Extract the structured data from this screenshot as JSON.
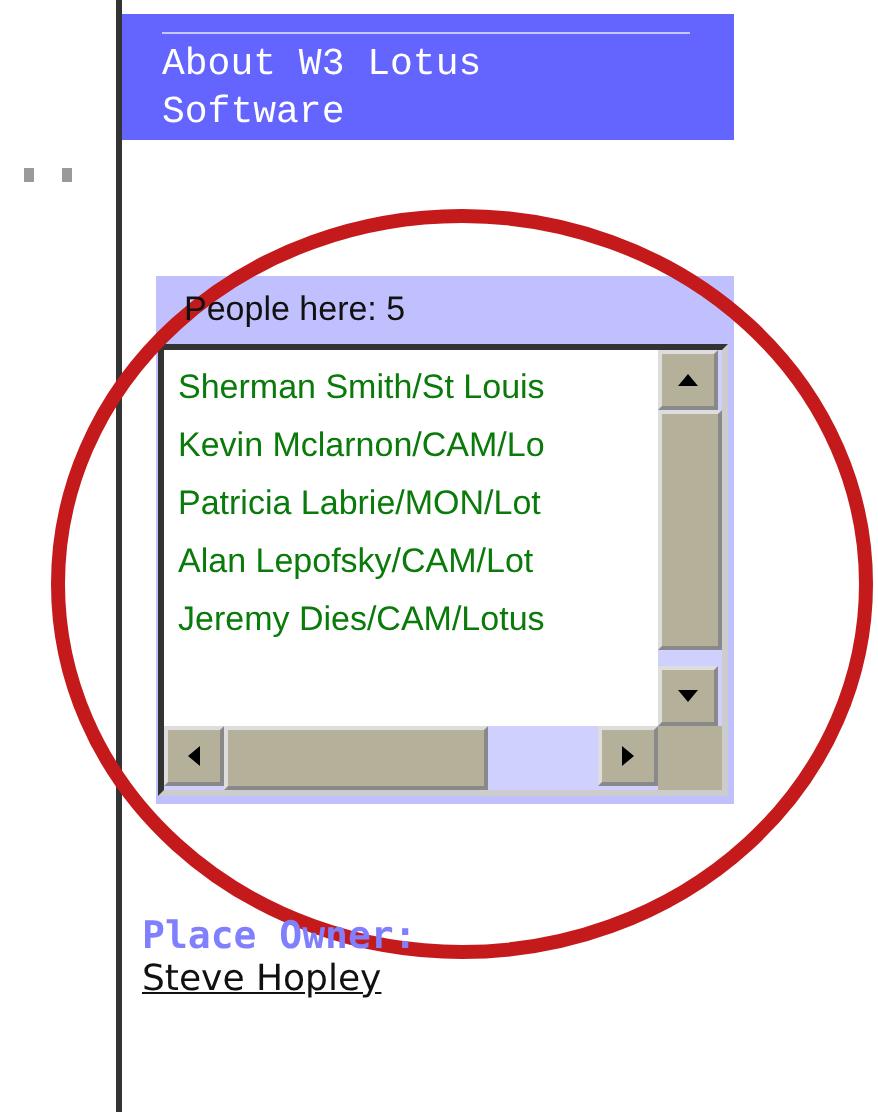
{
  "nav_link": {
    "label": "About W3 Lotus Software"
  },
  "people_panel": {
    "title": "People here: 5",
    "people": [
      {
        "name": "Sherman Smith/St Louis"
      },
      {
        "name": "Kevin Mclarnon/CAM/Lo"
      },
      {
        "name": "Patricia Labrie/MON/Lot"
      },
      {
        "name": "Alan Lepofsky/CAM/Lot"
      },
      {
        "name": "Jeremy Dies/CAM/Lotus"
      }
    ]
  },
  "place_owner": {
    "label": "Place Owner:",
    "name": "Steve Hopley"
  },
  "annotation": {
    "kind": "circle"
  }
}
